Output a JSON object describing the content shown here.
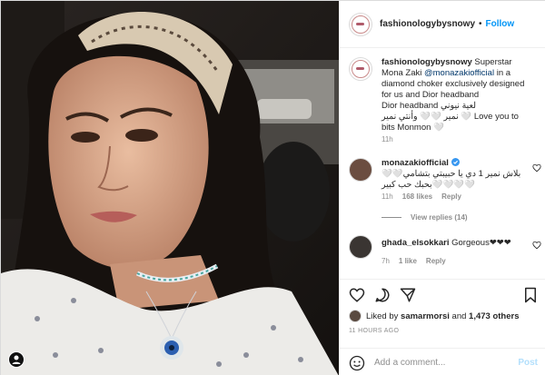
{
  "post": {
    "username": "fashionologybysnowy",
    "follow_label": "Follow",
    "separator": "•"
  },
  "caption": {
    "username": "fashionologybysnowy",
    "text_before": "Superstar Mona Zaki",
    "mention": "@monazakiofficial",
    "text_after": "in a diamond choker exclusively designed for us and Dior headband",
    "line_ar": "لعية نيوني  Dior headband",
    "line_ar2": "نمير 🤍🤍 وأنتي نمير 🤍 Love you to bits Monmon 🤍",
    "time": "11h"
  },
  "comments": [
    {
      "username": "monazakiofficial",
      "verified": true,
      "text": "بلاش نمير 1 دي يا حبيبتي بتشامي🤍🤍🤍🤍🤍🤍بحبك حب كبير",
      "time": "11h",
      "likes": "168 likes",
      "reply": "Reply",
      "view_replies": "View replies (14)"
    },
    {
      "username": "ghada_elsokkari",
      "text": "Gorgeous❤❤❤",
      "time": "7h",
      "likes": "1 like",
      "reply": "Reply"
    }
  ],
  "likes": {
    "prefix": "Liked by",
    "user": "samarmorsi",
    "middle": "and",
    "count": "1,473 others"
  },
  "timestamp": "11 HOURS AGO",
  "comment_box": {
    "placeholder": "Add a comment...",
    "post_label": "Post"
  },
  "colors": {
    "accent": "#0095f6",
    "mention": "#00376b",
    "muted": "#8e8e8e",
    "post_disabled": "#b2dffc"
  },
  "icons": [
    "heart-icon",
    "comment-icon",
    "share-icon",
    "bookmark-icon",
    "emoji-icon",
    "verified-icon",
    "user-tag-icon"
  ]
}
